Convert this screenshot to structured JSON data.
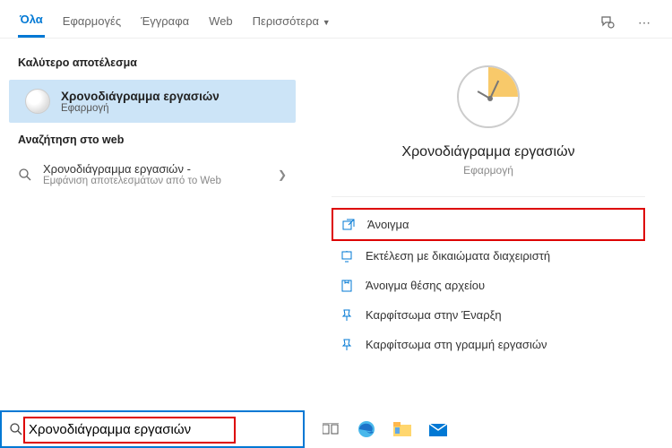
{
  "tabs": {
    "all": "Όλα",
    "apps": "Εφαρμογές",
    "docs": "Έγγραφα",
    "web": "Web",
    "more": "Περισσότερα"
  },
  "left": {
    "best_header": "Καλύτερο αποτέλεσμα",
    "best_title": "Χρονοδιάγραμμα εργασιών",
    "best_sub": "Εφαρμογή",
    "web_header": "Αναζήτηση στο web",
    "web_line1": "Χρονοδιάγραμμα εργασιών -",
    "web_line2": "Εμφάνιση αποτελεσμάτων από το Web"
  },
  "preview": {
    "title": "Χρονοδιάγραμμα εργασιών",
    "sub": "Εφαρμογή"
  },
  "actions": {
    "open": "Άνοιγμα",
    "admin": "Εκτέλεση με δικαιώματα διαχειριστή",
    "location": "Άνοιγμα θέσης αρχείου",
    "pin_start": "Καρφίτσωμα στην Έναρξη",
    "pin_tb": "Καρφίτσωμα στη γραμμή εργασιών"
  },
  "search": {
    "value": "Χρονοδιάγραμμα εργασιών"
  }
}
